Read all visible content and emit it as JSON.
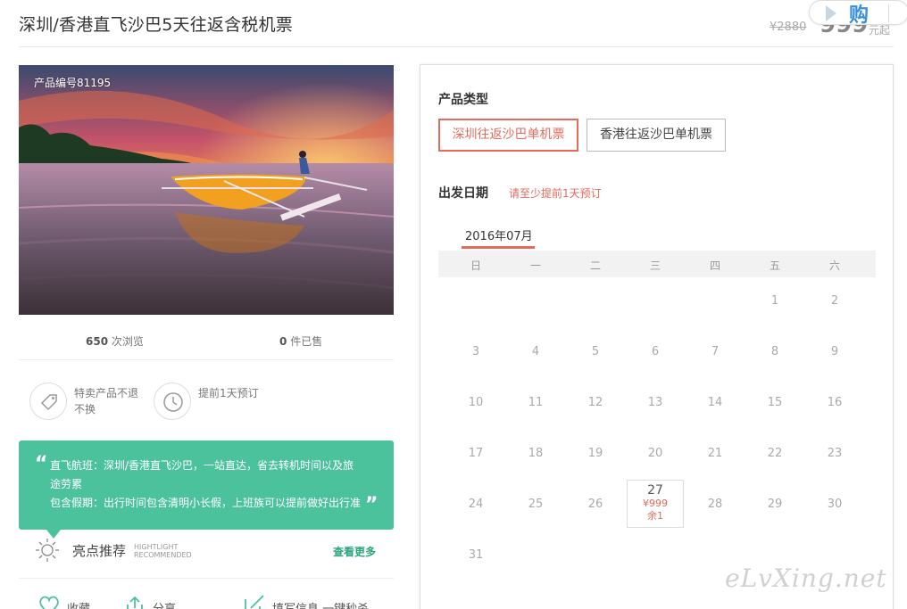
{
  "header": {
    "title": "深圳/香港直飞沙巴5天往返含税机票",
    "old_price": "¥2880",
    "new_price": "999",
    "price_suffix": "元起",
    "buy_label": "购"
  },
  "product": {
    "code": "产品编号81195",
    "views_count": "650",
    "views_label": "次浏览",
    "sold_count": "0",
    "sold_label": "件已售"
  },
  "features": [
    {
      "icon": "tag-icon",
      "text": "特卖产品不退不换"
    },
    {
      "icon": "clock-icon",
      "text": "提前1天预订"
    }
  ],
  "highlight_box": {
    "line1": "直飞航班：深圳/香港直飞沙巴，一站直达，省去转机时间以及旅途劳累",
    "line2": "包含假期：出行时间包含清明小长假，上班族可以提前做好出行准",
    "open_quote": "“",
    "close_quote": "”"
  },
  "highlights": {
    "title": "亮点推荐",
    "en_line1": "HIGHTLIGHT",
    "en_line2": "RECOMMENDED",
    "more": "查看更多"
  },
  "actions": [
    {
      "icon": "heart-icon",
      "label": "收藏"
    },
    {
      "icon": "share-icon",
      "label": "分享"
    },
    {
      "icon": "edit-icon",
      "label": "填写信息 一键秒杀"
    }
  ],
  "booking": {
    "type_label": "产品类型",
    "types": [
      "深圳往返沙巴单机票",
      "香港往返沙巴单机票"
    ],
    "selected_type": 0,
    "date_label": "出发日期",
    "date_hint": "请至少提前1天预订",
    "month": "2016年07月",
    "weekdays": [
      "日",
      "一",
      "二",
      "三",
      "四",
      "五",
      "六"
    ],
    "days": [
      "",
      "",
      "",
      "",
      "",
      "1",
      "2",
      "3",
      "4",
      "5",
      "6",
      "7",
      "8",
      "9",
      "10",
      "11",
      "12",
      "13",
      "14",
      "15",
      "16",
      "17",
      "18",
      "19",
      "20",
      "21",
      "22",
      "23",
      "24",
      "25",
      "26",
      "27",
      "28",
      "29",
      "30",
      "31"
    ],
    "available": {
      "day": "27",
      "price": "¥999",
      "left": "余1"
    }
  },
  "watermark": "eLvXing.net",
  "colors": {
    "accent": "#e46a5c",
    "green": "#4bc29c",
    "link_green": "#2aa57c",
    "buy_blue": "#3b8fd6"
  }
}
